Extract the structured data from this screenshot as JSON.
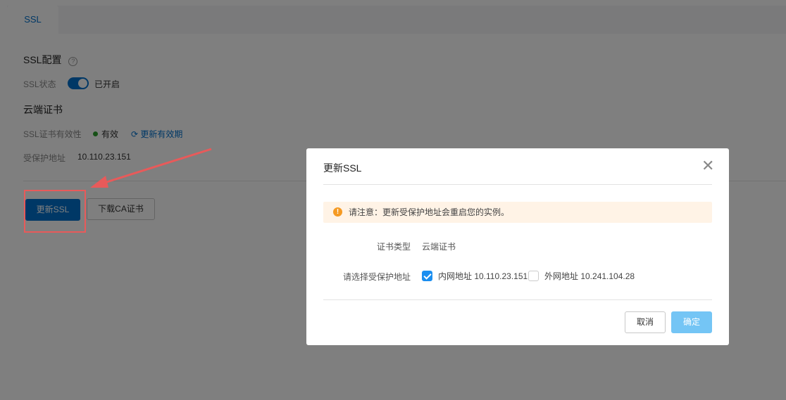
{
  "page": {
    "tab": "SSL",
    "section_title": "SSL配置",
    "ssl_status_label": "SSL状态",
    "ssl_status_value": "已开启",
    "cert_title": "云端证书",
    "validity_label": "SSL证书有效性",
    "validity_value": "有效",
    "renew_validity": "更新有效期",
    "protected_label": "受保护地址",
    "protected_value": "10.110.23.151",
    "update_ssl_button": "更新SSL",
    "download_ca_button": "下载CA证书"
  },
  "modal": {
    "title": "更新SSL",
    "alert": "请注意：更新受保护地址会重启您的实例。",
    "cert_type_label": "证书类型",
    "cert_type_value": "云端证书",
    "address_label": "请选择受保护地址",
    "options": [
      {
        "label": "内网地址 10.110.23.151",
        "checked": true
      },
      {
        "label": "外网地址 10.241.104.28",
        "checked": false
      }
    ],
    "cancel": "取消",
    "confirm": "确定"
  },
  "colors": {
    "accent": "#0070cc",
    "annotation": "#e85a5a",
    "warning": "#f59a23"
  }
}
